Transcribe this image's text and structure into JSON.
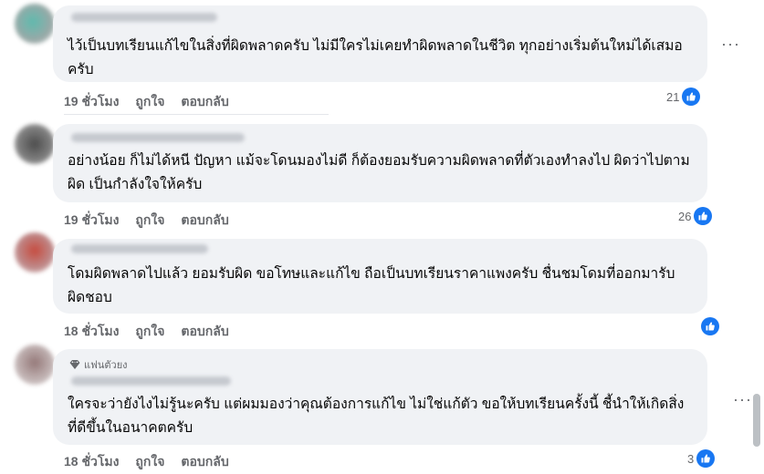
{
  "comments": [
    {
      "text": "ไว้เป็นบทเรียนแก้ไขในสิ่งที่ผิดพลาดครับ ไม่มีใครไม่เคยทำผิดพลาดในชีวิต ทุกอย่างเริ่มต้นใหม่ได้เสมอครับ",
      "time": "19 ชั่วโมง",
      "like_label": "ถูกใจ",
      "reply_label": "ตอบกลับ",
      "reactions": "21"
    },
    {
      "text": "อย่างน้อย ก็ไม่ได้หนี ปัญหา แม้จะโดนมองไม่ดี ก็ต้องยอมรับความผิดพลาดที่ตัวเองทำลงไป ผิดว่าไปตามผิด เป็นกำลังใจให้ครับ",
      "time": "19 ชั่วโมง",
      "like_label": "ถูกใจ",
      "reply_label": "ตอบกลับ",
      "reactions": "26"
    },
    {
      "text": "โดมผิดพลาดไปแล้ว ยอมรับผิด ขอโทษและแก้ไข ถือเป็นบทเรียนราคาแพงครับ ชื่นชมโดมที่ออกมารับผิดชอบ",
      "time": "18 ชั่วโมง",
      "like_label": "ถูกใจ",
      "reply_label": "ตอบกลับ",
      "reactions": ""
    },
    {
      "badge": "แฟนตัวยง",
      "text": "ใครจะว่ายังไงไม่รู้นะครับ แต่ผมมองว่าคุณต้องการแก้ไข ไม่ใช่แก้ตัว ขอให้บทเรียนครั้งนี้ ชี้นำให้เกิดสิ่งที่ดีขึ้นในอนาคตครับ",
      "time": "18 ชั่วโมง",
      "like_label": "ถูกใจ",
      "reply_label": "ตอบกลับ",
      "reactions": "3"
    }
  ],
  "colors": {
    "bubble": "#f0f2f5",
    "like_blue": "#1877f2",
    "secondary_text": "#65676b"
  },
  "icons": {
    "like": "thumbs-up-icon",
    "more": "more-options-icon",
    "badge": "diamond-icon"
  }
}
